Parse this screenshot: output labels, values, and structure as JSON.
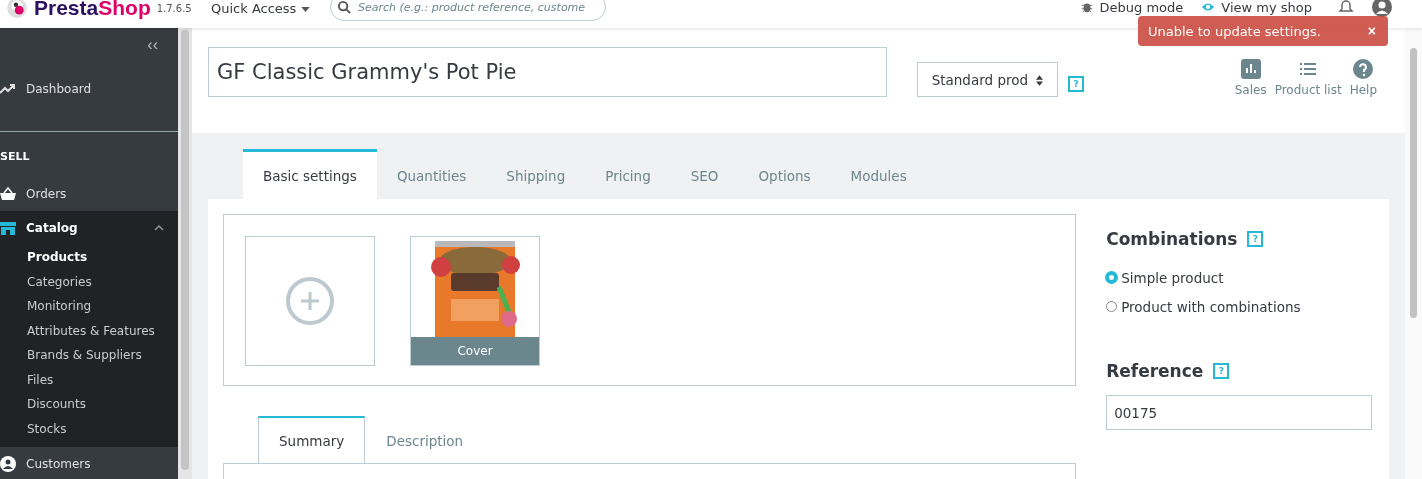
{
  "header": {
    "logo": "PrestaShop",
    "version": "1.7.6.5",
    "quick_access": "Quick Access",
    "search": {
      "placeholder": "Search (e.g.: product reference, custome"
    },
    "debug": "Debug mode",
    "view_shop": "View my shop"
  },
  "toast": {
    "message": "Unable to update settings.",
    "close": "×"
  },
  "sidebar": {
    "collapse": "‹‹",
    "dashboard": "Dashboard",
    "section": "SELL",
    "items": [
      {
        "label": "Orders",
        "expanded": false
      },
      {
        "label": "Catalog",
        "expanded": true,
        "children": [
          {
            "label": "Products",
            "selected": true
          },
          {
            "label": "Categories",
            "selected": false
          },
          {
            "label": "Monitoring",
            "selected": false
          },
          {
            "label": "Attributes & Features",
            "selected": false
          },
          {
            "label": "Brands & Suppliers",
            "selected": false
          },
          {
            "label": "Files",
            "selected": false
          },
          {
            "label": "Discounts",
            "selected": false
          },
          {
            "label": "Stocks",
            "selected": false
          }
        ]
      },
      {
        "label": "Customers",
        "expanded": false
      }
    ]
  },
  "product": {
    "name": "GF Classic Grammy's Pot Pie",
    "type": "Standard prod",
    "help": "?"
  },
  "toolbar": [
    {
      "label": "Sales"
    },
    {
      "label": "Product list"
    },
    {
      "label": "Help"
    }
  ],
  "tabs": [
    {
      "label": "Basic settings",
      "selected": true
    },
    {
      "label": "Quantities",
      "selected": false
    },
    {
      "label": "Shipping",
      "selected": false
    },
    {
      "label": "Pricing",
      "selected": false
    },
    {
      "label": "SEO",
      "selected": false
    },
    {
      "label": "Options",
      "selected": false
    },
    {
      "label": "Modules",
      "selected": false
    }
  ],
  "images": {
    "cover_label": "Cover"
  },
  "combinations": {
    "title": "Combinations",
    "help": "?",
    "options": [
      {
        "label": "Simple product",
        "selected": true
      },
      {
        "label": "Product with combinations",
        "selected": false
      }
    ]
  },
  "reference": {
    "title": "Reference",
    "help": "?",
    "value": "00175"
  },
  "desc_tabs": [
    {
      "label": "Summary",
      "selected": true
    },
    {
      "label": "Description",
      "selected": false
    }
  ]
}
